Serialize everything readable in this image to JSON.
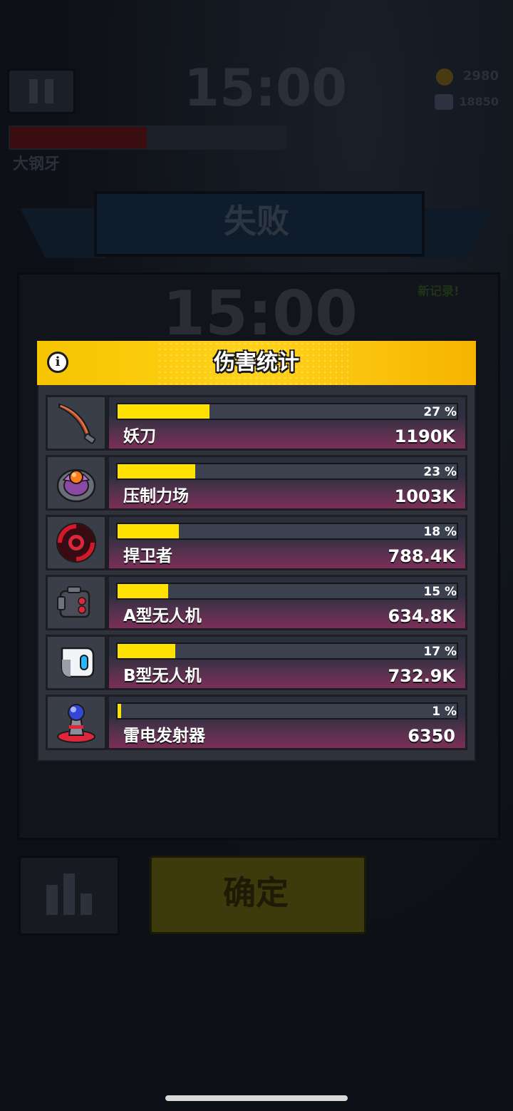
{
  "hud": {
    "timer": "15:00",
    "coins": "2980",
    "gems": "18850",
    "boss_name": "大钢牙",
    "boss_hp_fraction": 0.5
  },
  "result": {
    "title": "失败",
    "timer": "15:00",
    "new_record": "新记录!",
    "confirm_label": "确定"
  },
  "modal": {
    "title": "伤害统计",
    "info_icon_glyph": "i",
    "rows": [
      {
        "name": "妖刀",
        "percent_label": "27 %",
        "fraction": 0.27,
        "damage": "1190K",
        "icon": "demon-blade-icon"
      },
      {
        "name": "压制力场",
        "percent_label": "23 %",
        "fraction": 0.23,
        "damage": "1003K",
        "icon": "suppression-field-icon"
      },
      {
        "name": "捍卫者",
        "percent_label": "18 %",
        "fraction": 0.18,
        "damage": "788.4K",
        "icon": "defender-icon"
      },
      {
        "name": "A型无人机",
        "percent_label": "15 %",
        "fraction": 0.15,
        "damage": "634.8K",
        "icon": "drone-a-icon"
      },
      {
        "name": "B型无人机",
        "percent_label": "17 %",
        "fraction": 0.17,
        "damage": "732.9K",
        "icon": "drone-b-icon"
      },
      {
        "name": "雷电发射器",
        "percent_label": "1 %",
        "fraction": 0.01,
        "damage": "6350",
        "icon": "lightning-emitter-icon"
      }
    ]
  },
  "colors": {
    "header": "#f6c400",
    "bar_fill": "#ffe100",
    "row_accent": "#b8356e"
  }
}
